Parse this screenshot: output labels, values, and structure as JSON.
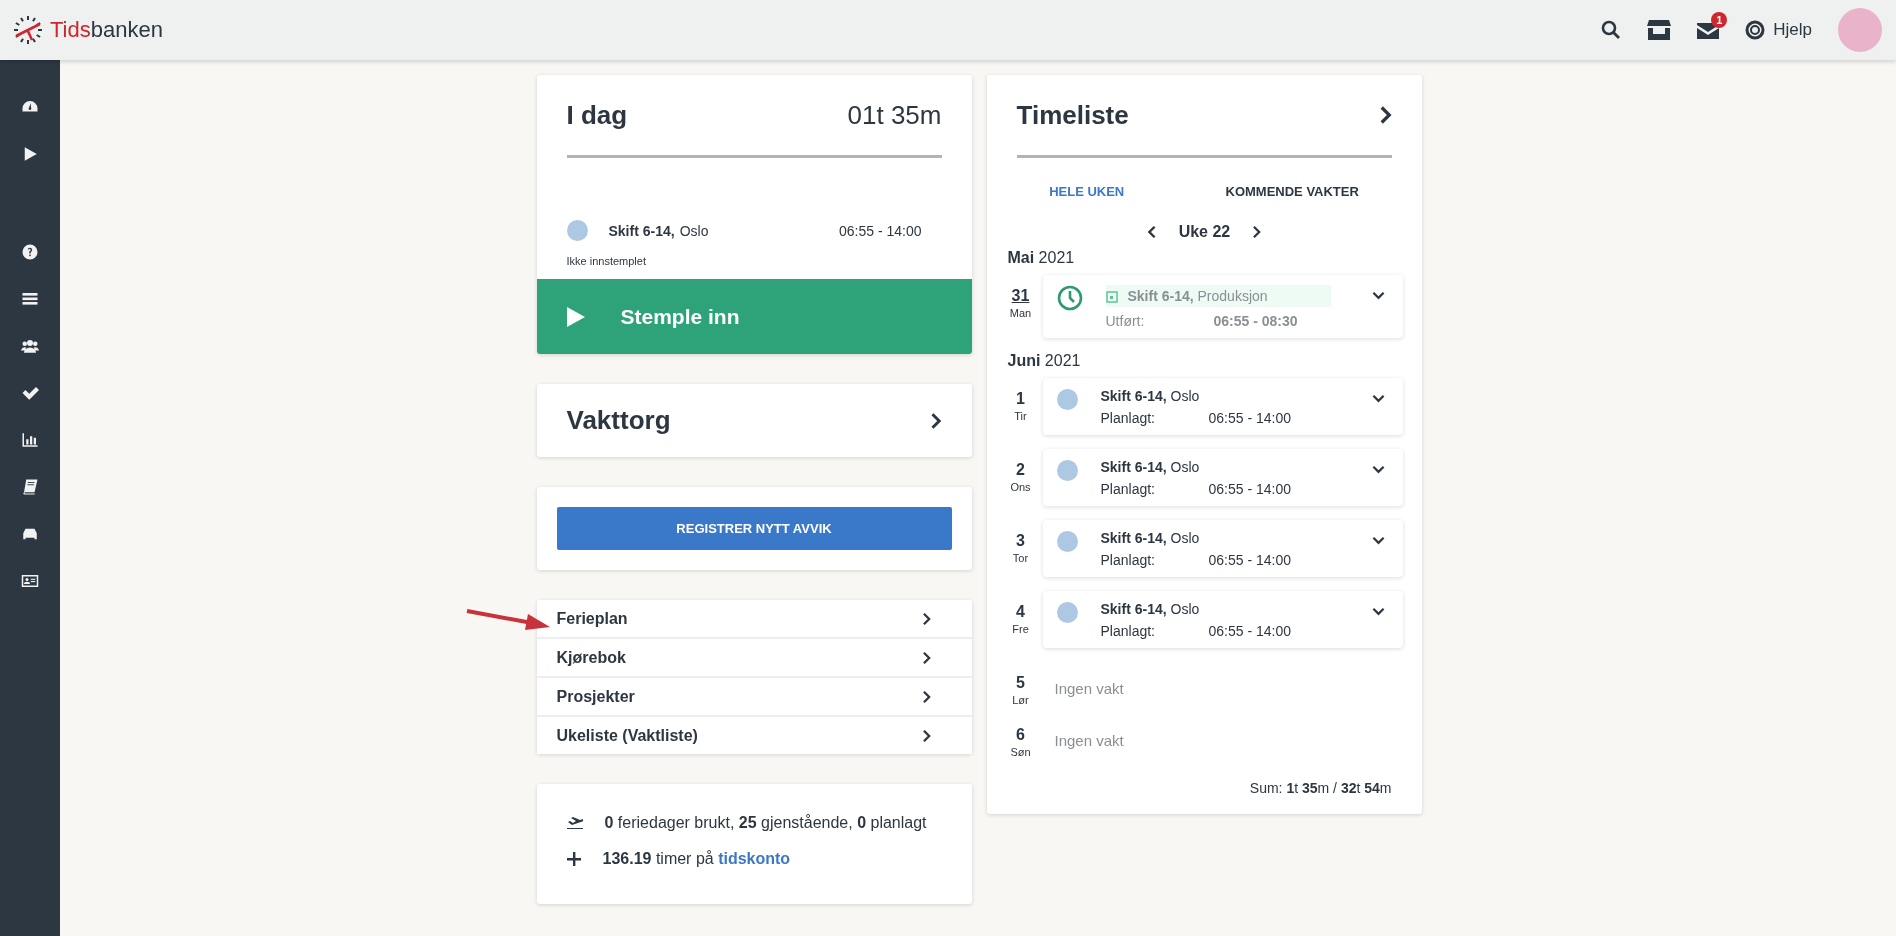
{
  "header": {
    "logo": {
      "accent": "Tids",
      "rest": "banken"
    },
    "mail_badge": "1",
    "help": "Hjelp"
  },
  "today": {
    "title": "I dag",
    "total": "01t 35m",
    "shift": {
      "name": "Skift 6-14,",
      "place": "Oslo",
      "time": "06:55 - 14:00"
    },
    "status": "Ikke innstemplet",
    "action": "Stemple inn"
  },
  "vakttorg": {
    "title": "Vakttorg"
  },
  "deviation_button": "REGISTRER NYTT AVVIK",
  "links": [
    "Ferieplan",
    "Kjørebok",
    "Prosjekter",
    "Ukeliste (Vaktliste)"
  ],
  "stats": {
    "vacation": "**0** feriedager brukt, **25** gjenstående, **0** planlagt",
    "balance": "**136.19** timer på ",
    "balance_link": "tidskonto"
  },
  "timeliste": {
    "title": "Timeliste",
    "tabs": [
      {
        "label": "HELE UKEN",
        "selected": true
      },
      {
        "label": "KOMMENDE VAKTER",
        "selected": false
      }
    ],
    "week": "Uke 22",
    "months": [
      {
        "heading": "**Mai** 2021",
        "days": [
          {
            "date": "31",
            "weekday": "Man",
            "today": true,
            "kind": "done",
            "shift": "Skift 6-14,",
            "place": "Produksjon",
            "label": "Utført:",
            "time": "06:55 - 08:30"
          }
        ]
      },
      {
        "heading": "**Juni** 2021",
        "days": [
          {
            "date": "1",
            "weekday": "Tir",
            "today": false,
            "kind": "planned",
            "shift": "Skift 6-14,",
            "place": "Oslo",
            "label": "Planlagt:",
            "time": "06:55 - 14:00"
          },
          {
            "date": "2",
            "weekday": "Ons",
            "today": false,
            "kind": "planned",
            "shift": "Skift 6-14,",
            "place": "Oslo",
            "label": "Planlagt:",
            "time": "06:55 - 14:00"
          },
          {
            "date": "3",
            "weekday": "Tor",
            "today": false,
            "kind": "planned",
            "shift": "Skift 6-14,",
            "place": "Oslo",
            "label": "Planlagt:",
            "time": "06:55 - 14:00"
          },
          {
            "date": "4",
            "weekday": "Fre",
            "today": false,
            "kind": "planned",
            "shift": "Skift 6-14,",
            "place": "Oslo",
            "label": "Planlagt:",
            "time": "06:55 - 14:00"
          },
          {
            "date": "5",
            "weekday": "Lør",
            "today": false,
            "kind": "empty",
            "text": "Ingen vakt"
          },
          {
            "date": "6",
            "weekday": "Søn",
            "today": false,
            "kind": "empty",
            "text": "Ingen vakt"
          }
        ]
      }
    ],
    "sum": "Sum: **1**t **35**m / **32**t **54**m"
  }
}
